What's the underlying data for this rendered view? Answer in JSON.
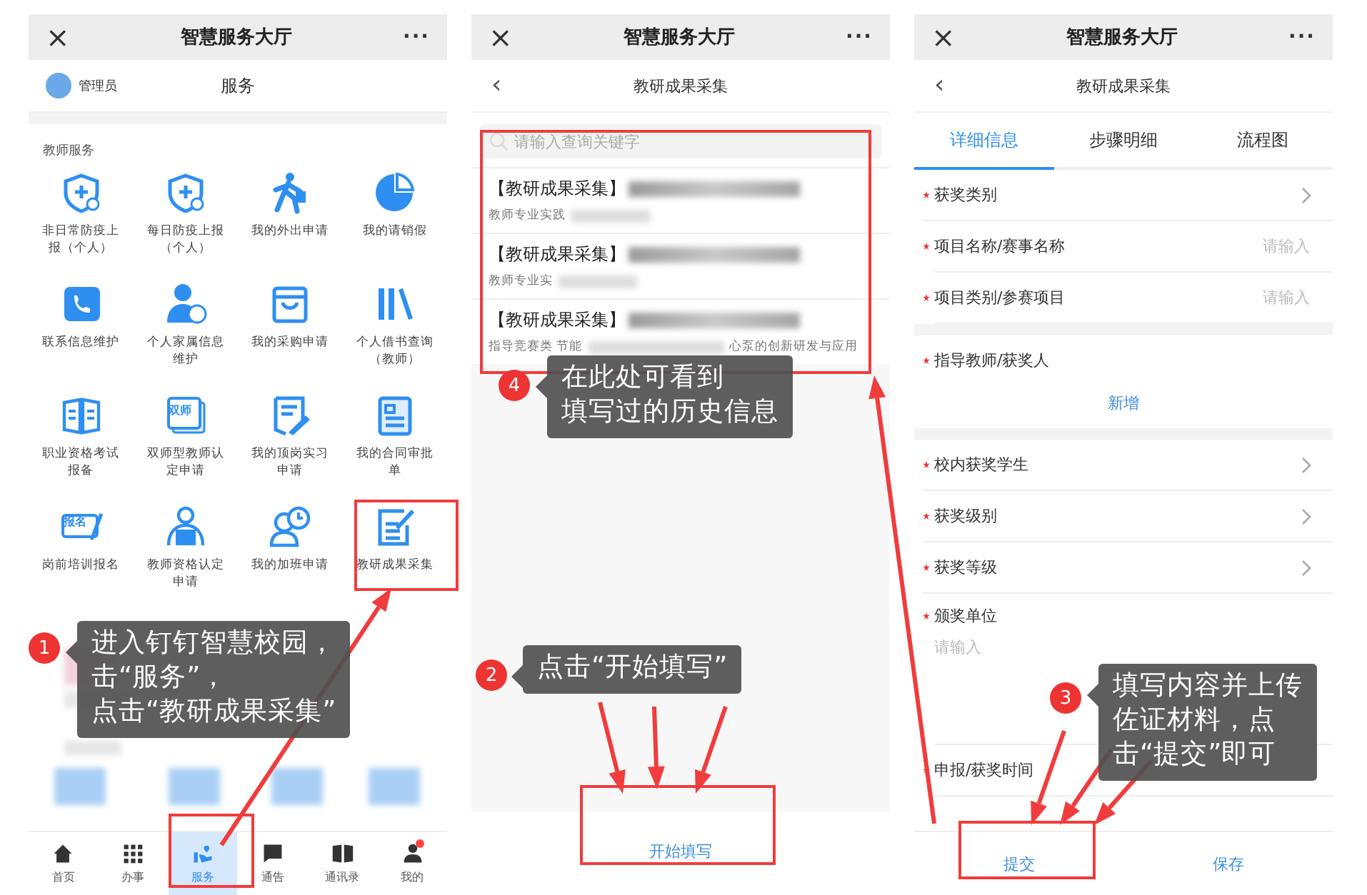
{
  "home_screen": {
    "app_bar": {
      "close": "×",
      "title": "智慧服务大厅",
      "more": "···"
    },
    "user": {
      "name": "管理员"
    },
    "page_title": "服务",
    "section_label": "教师服务",
    "services": [
      {
        "label": "非日常防疫上报（个人）"
      },
      {
        "label": "每日防疫上报（个人）"
      },
      {
        "label": "我的外出申请"
      },
      {
        "label": "我的请销假"
      },
      {
        "label": "联系信息维护"
      },
      {
        "label": "个人家属信息维护"
      },
      {
        "label": "我的采购申请"
      },
      {
        "label": "个人借书查询（教师）"
      },
      {
        "label": "职业资格考试报备"
      },
      {
        "label": "双师型教师认定申请",
        "icon_text": "双师"
      },
      {
        "label": "我的顶岗实习申请"
      },
      {
        "label": "我的合同审批单"
      },
      {
        "label": "岗前培训报名",
        "icon_text": "报名"
      },
      {
        "label": "教师资格认定申请"
      },
      {
        "label": "我的加班申请"
      },
      {
        "label": "教研成果采集"
      }
    ],
    "tab_bar": [
      {
        "label": "首页",
        "selected": false,
        "badge": false
      },
      {
        "label": "办事",
        "selected": false,
        "badge": false
      },
      {
        "label": "服务",
        "selected": true,
        "badge": false
      },
      {
        "label": "通告",
        "selected": false,
        "badge": false
      },
      {
        "label": "通讯录",
        "selected": false,
        "badge": false
      },
      {
        "label": "我的",
        "selected": false,
        "badge": true
      }
    ]
  },
  "list_screen": {
    "app_bar": {
      "close": "×",
      "title": "智慧服务大厅",
      "more": "···"
    },
    "nav": {
      "back": "‹",
      "title": "教研成果采集"
    },
    "search": {
      "placeholder": "请输入查询关键字"
    },
    "records": [
      {
        "title": "【教研成果采集】",
        "subtitle": "教师专业实践"
      },
      {
        "title": "【教研成果采集】",
        "subtitle": "教师专业实"
      },
      {
        "title": "【教研成果采集】",
        "subtitle": "指导竞赛类 节能",
        "subtitle_end": "心泵的创新研发与应用"
      }
    ],
    "start_button": "开始填写"
  },
  "form_screen": {
    "app_bar": {
      "close": "×",
      "title": "智慧服务大厅",
      "more": "···"
    },
    "nav": {
      "back": "‹",
      "title": "教研成果采集"
    },
    "tabs": [
      {
        "label": "详细信息",
        "selected": true
      },
      {
        "label": "步骤明细",
        "selected": false
      },
      {
        "label": "流程图",
        "selected": false
      }
    ],
    "sections": [
      {
        "rows": [
          {
            "label": "获奖类别",
            "required": true,
            "kind": "select"
          },
          {
            "label": "项目名称/赛事名称",
            "required": true,
            "kind": "input",
            "placeholder": "请输入"
          },
          {
            "label": "项目类别/参赛项目",
            "required": true,
            "kind": "input",
            "placeholder": "请输入"
          }
        ]
      },
      {
        "rows": [
          {
            "label": "指导教师/获奖人",
            "required": true,
            "kind": "adder",
            "action": "新增"
          }
        ]
      },
      {
        "rows": [
          {
            "label": "校内获奖学生",
            "required": true,
            "kind": "select"
          },
          {
            "label": "获奖级别",
            "required": true,
            "kind": "select"
          },
          {
            "label": "获奖等级",
            "required": true,
            "kind": "select"
          },
          {
            "label": "颁奖单位",
            "required": true,
            "kind": "textarea",
            "placeholder": "请输入"
          },
          {
            "label": "申报/获奖时间",
            "required": true,
            "kind": "plain"
          }
        ]
      }
    ],
    "actions": [
      {
        "label": "提交"
      },
      {
        "label": "保存"
      }
    ]
  },
  "callouts": [
    {
      "number": "1",
      "lines": [
        "进入钉钉智慧校园，",
        "击“服务”，",
        "点击“教研成果采集”"
      ]
    },
    {
      "number": "2",
      "lines": [
        "点击“开始填写”"
      ]
    },
    {
      "number": "3",
      "lines": [
        "填写内容并上传",
        "佐证材料，点",
        "击“提交”即可"
      ]
    },
    {
      "number": "4",
      "lines": [
        "在此处可看到",
        "填写过的历史信息"
      ]
    }
  ]
}
